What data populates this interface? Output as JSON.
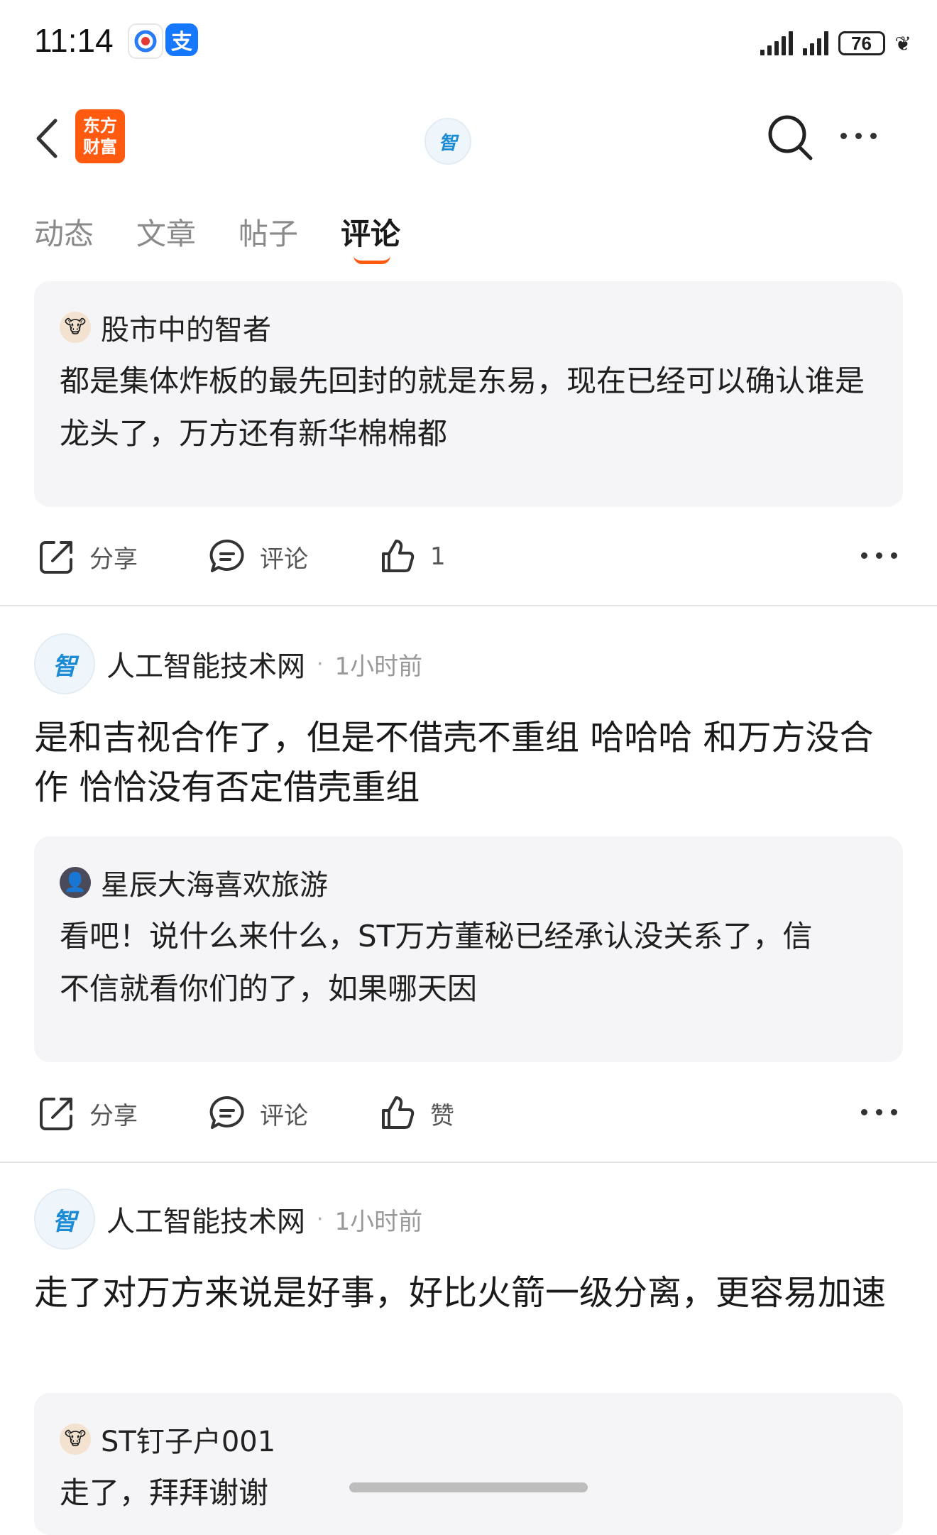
{
  "status_bar": {
    "time": "11:14",
    "battery": "76"
  },
  "header": {
    "brand_logo": "东方\n财富",
    "center_avatar_text": "智"
  },
  "tabs": [
    {
      "label": "动态"
    },
    {
      "label": "文章"
    },
    {
      "label": "帖子"
    },
    {
      "label": "评论"
    }
  ],
  "active_tab": "评论",
  "feed": {
    "item1": {
      "quote_user": "股市中的智者",
      "quote_text": "都是集体炸板的最先回封的就是东易，现在已经可以确认谁是龙头了，万方还有新华棉棉都",
      "share": "分享",
      "comment": "评论",
      "likes": "1"
    },
    "item2": {
      "author": "人工智能技术网",
      "dot": "·",
      "time": "1小时前",
      "text": "是和吉视合作了，但是不借壳不重组 哈哈哈  和万方没合作 恰恰没有否定借壳重组",
      "quote_user": "星辰大海喜欢旅游",
      "quote_text": "看吧！说什么来什么，ST万方董秘已经承认没关系了，信不信就看你们的了，如果哪天因",
      "share": "分享",
      "comment": "评论",
      "likes": "赞"
    },
    "item3": {
      "author": "人工智能技术网",
      "dot": "·",
      "time": "1小时前",
      "text": "走了对万方来说是好事，好比火箭一级分离，更容易加速",
      "quote_user": "ST钉子户001",
      "quote_text": "走了，拜拜谢谢"
    }
  },
  "colors": {
    "accent": "#ff5a10",
    "quote_bg": "#f5f5f7",
    "avatar_blue": "#1b8bd6"
  },
  "icons": [
    "back-arrow-icon",
    "search-icon",
    "more-icon",
    "share-icon",
    "comment-icon",
    "like-icon"
  ]
}
